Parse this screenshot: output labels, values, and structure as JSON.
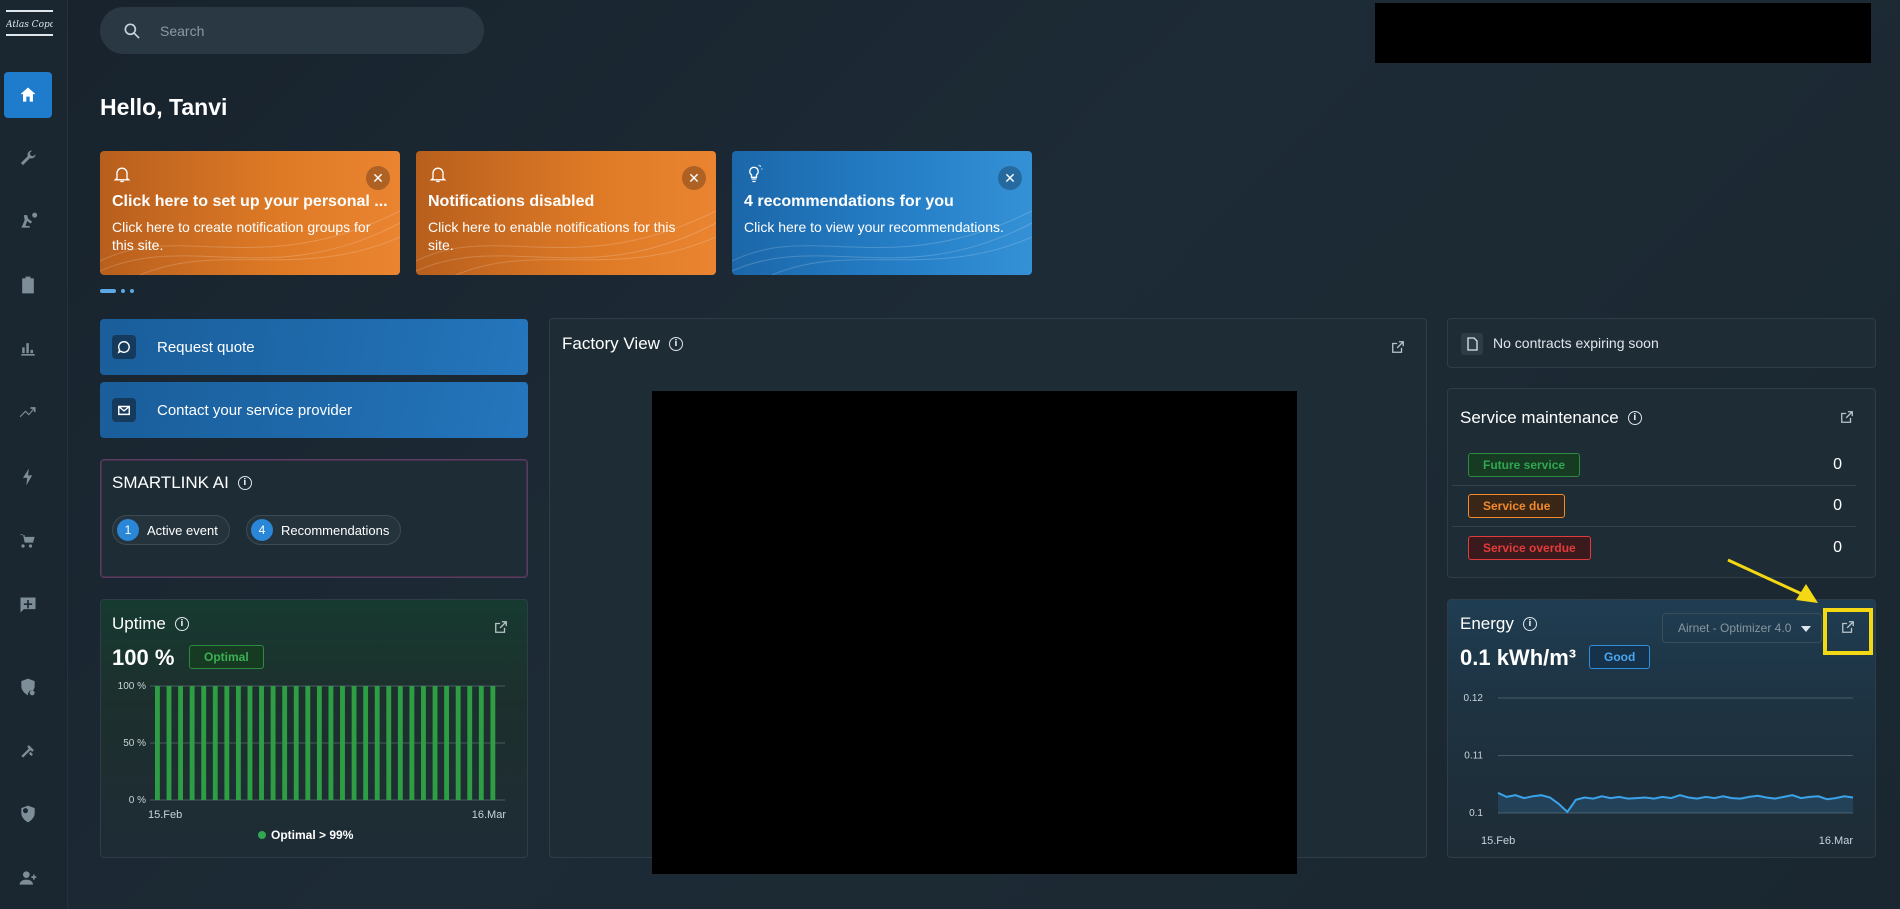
{
  "app": {
    "logo_text": "Atlas Copco"
  },
  "sidebar": {
    "items": [
      {
        "name": "home",
        "icon": "home-icon"
      },
      {
        "name": "service",
        "icon": "wrench-icon"
      },
      {
        "name": "machines",
        "icon": "compressor-icon"
      },
      {
        "name": "reports",
        "icon": "clipboard-icon"
      },
      {
        "name": "analytics",
        "icon": "bar-chart-icon"
      },
      {
        "name": "trends",
        "icon": "trend-icon"
      },
      {
        "name": "energy",
        "icon": "lightning-icon"
      },
      {
        "name": "shop",
        "icon": "cart-icon"
      },
      {
        "name": "feedback",
        "icon": "feedback-icon"
      },
      {
        "name": "security-alerts",
        "icon": "shield-clock-icon"
      },
      {
        "name": "tools",
        "icon": "tools-icon"
      },
      {
        "name": "protection",
        "icon": "shield-icon"
      },
      {
        "name": "add-user",
        "icon": "add-user-icon"
      }
    ]
  },
  "search": {
    "placeholder": "Search"
  },
  "greeting": "Hello, Tanvi",
  "notifications": [
    {
      "title": "Click here to set up your personal ...",
      "text": "Click here to create notification groups for this site.",
      "icon": "bell-icon"
    },
    {
      "title": "Notifications disabled",
      "text": "Click here to enable notifications for this site.",
      "icon": "bell-icon"
    },
    {
      "title": "4 recommendations for you",
      "text": "Click here to view your recommendations.",
      "icon": "lightbulb-icon"
    }
  ],
  "actions": {
    "request_quote": "Request quote",
    "contact_provider": "Contact your service provider"
  },
  "smartlink": {
    "title": "SMARTLINK AI",
    "pills": [
      {
        "count": "1",
        "label": "Active event"
      },
      {
        "count": "4",
        "label": "Recommendations"
      }
    ]
  },
  "uptime": {
    "title": "Uptime",
    "value": "100 %",
    "badge": "Optimal",
    "legend": "Optimal > 99%",
    "chart_data": {
      "type": "bar",
      "ylim": [
        0,
        100
      ],
      "yticks": [
        "100 %",
        "50 %",
        "0 %"
      ],
      "x_start_label": "15.Feb",
      "x_end_label": "16.Mar",
      "values": [
        100,
        100,
        100,
        100,
        100,
        100,
        100,
        100,
        100,
        100,
        100,
        100,
        100,
        100,
        100,
        100,
        100,
        100,
        100,
        100,
        100,
        100,
        100,
        100,
        100,
        100,
        100,
        100,
        100,
        100
      ],
      "color": "#2e9e45"
    }
  },
  "factory": {
    "title": "Factory View"
  },
  "contracts": {
    "text": "No contracts expiring soon"
  },
  "service_maintenance": {
    "title": "Service maintenance",
    "rows": [
      {
        "label": "Future service",
        "count": "0",
        "color": "#2fa84f"
      },
      {
        "label": "Service due",
        "count": "0",
        "color": "#f08a2c"
      },
      {
        "label": "Service overdue",
        "count": "0",
        "color": "#e23b3b"
      }
    ]
  },
  "energy": {
    "title": "Energy",
    "value": "0.1 kWh/m³",
    "badge": "Good",
    "dropdown": "Airnet - Optimizer 4.0",
    "chart_data": {
      "type": "area",
      "ylim": [
        0.1,
        0.12
      ],
      "yticks": [
        "0.12",
        "0.11",
        "0.1"
      ],
      "x_start_label": "15.Feb",
      "x_end_label": "16.Mar",
      "values": [
        0.1035,
        0.1028,
        0.1031,
        0.1026,
        0.1029,
        0.1031,
        0.1027,
        0.1016,
        0.1002,
        0.1023,
        0.1027,
        0.1025,
        0.1029,
        0.1026,
        0.1028,
        0.1025,
        0.1026,
        0.1027,
        0.1025,
        0.1028,
        0.1026,
        0.1031,
        0.1027,
        0.1025,
        0.1028,
        0.1026,
        0.1029,
        0.1026,
        0.1025,
        0.1028,
        0.103,
        0.1027,
        0.1025,
        0.1028,
        0.1031,
        0.1026,
        0.1028,
        0.1029,
        0.1024,
        0.1026,
        0.1029,
        0.1027
      ],
      "color": "#3ba3ea"
    }
  }
}
